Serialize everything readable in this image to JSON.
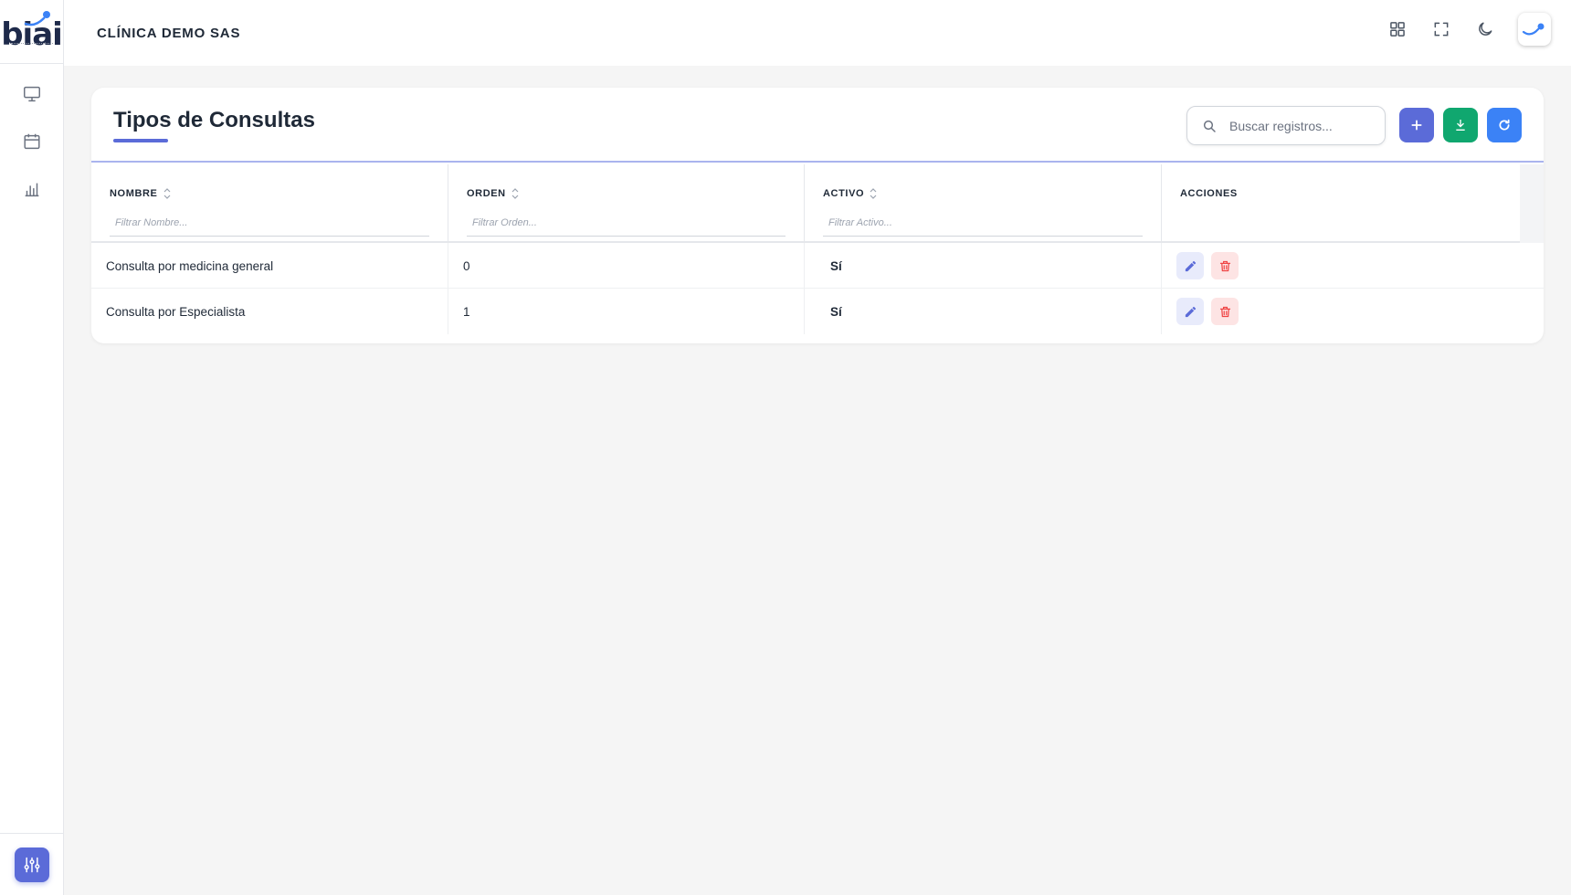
{
  "app": {
    "logo_text": "biai"
  },
  "topbar": {
    "company": "CLÍNICA DEMO SAS"
  },
  "sidebar": {
    "items": [
      {
        "name": "monitor-icon"
      },
      {
        "name": "calendar-icon"
      },
      {
        "name": "bar-chart-icon"
      }
    ]
  },
  "page": {
    "title": "Tipos de Consultas",
    "search": {
      "placeholder": "Buscar registros..."
    }
  },
  "table": {
    "columns": [
      {
        "label": "NOMBRE",
        "filter_placeholder": "Filtrar Nombre..."
      },
      {
        "label": "ORDEN",
        "filter_placeholder": "Filtrar Orden..."
      },
      {
        "label": "ACTIVO",
        "filter_placeholder": "Filtrar Activo..."
      },
      {
        "label": "ACCIONES"
      }
    ],
    "rows": [
      {
        "nombre": "Consulta por medicina general",
        "orden": "0",
        "activo": "Sí"
      },
      {
        "nombre": "Consulta por Especialista",
        "orden": "1",
        "activo": "Sí"
      }
    ]
  },
  "colors": {
    "primary": "#5b6bd8",
    "success": "#10a76f",
    "info": "#3b82f6",
    "danger": "#ef4444"
  }
}
